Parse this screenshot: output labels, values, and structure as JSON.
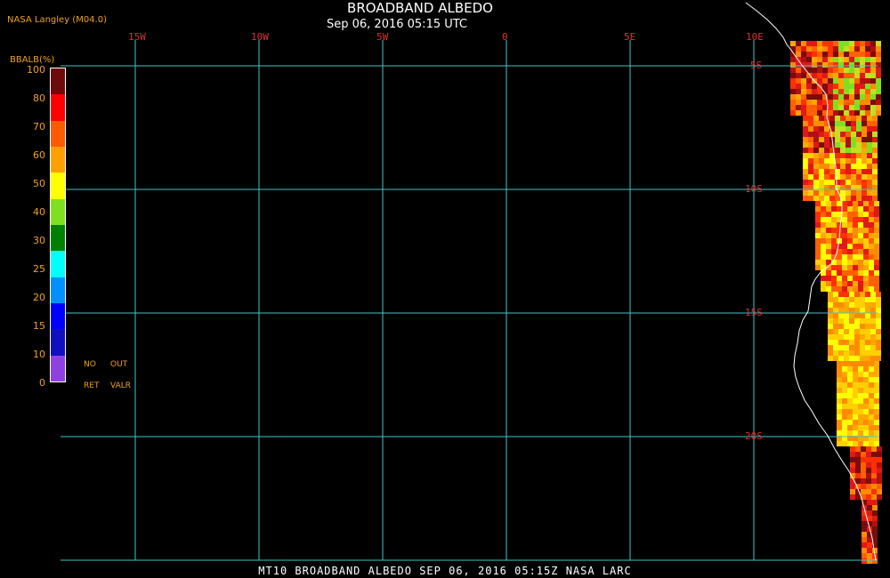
{
  "header": {
    "producer": "NASA Langley (M04.0)",
    "title": "BROADBAND ALBEDO",
    "subtitle": "Sep 06, 2016 05:15 UTC"
  },
  "map": {
    "lon_labels": [
      "15W",
      "10W",
      "5W",
      "0",
      "5E",
      "10E"
    ],
    "lat_labels": [
      "5S",
      "10S",
      "15S",
      "20S"
    ]
  },
  "colorbar": {
    "title": "BBALB(%)",
    "labels": [
      "100",
      "80",
      "70",
      "60",
      "50",
      "40",
      "30",
      "25",
      "20",
      "15",
      "10",
      "0"
    ],
    "colors": [
      "#6e0a0a",
      "#ff0000",
      "#ff5a00",
      "#ffa000",
      "#ffff00",
      "#80e020",
      "#008000",
      "#00ffff",
      "#0090ff",
      "#0000ff",
      "#1010c0",
      "#9040e0"
    ],
    "notes": [
      "NO",
      "OUT",
      "RET",
      "VALR"
    ]
  },
  "footer": {
    "text": "MT10   BROADBAND ALBEDO   SEP 06, 2016 05:15Z   NASA LARC"
  },
  "colors": {
    "grid": "#40c8c8",
    "coast": "#ffffff",
    "accent": "#f0a020",
    "tick": "#e03030"
  }
}
